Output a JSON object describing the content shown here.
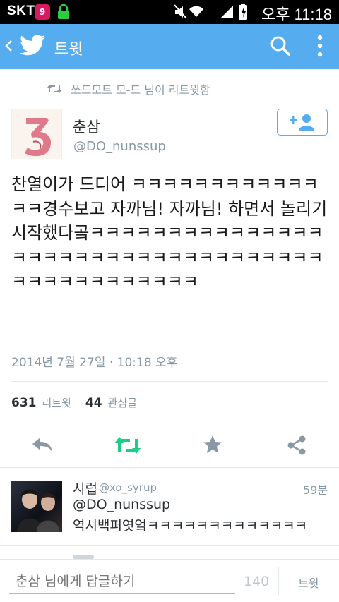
{
  "status_bar": {
    "carrier": "SKT",
    "notification_count": "9",
    "time": "오후 11:18"
  },
  "app_bar": {
    "title": "트윗"
  },
  "retweet_header": {
    "text": "쏘드모트 모-드 님이 리트윗함"
  },
  "tweet": {
    "author_name": "춘삼",
    "author_handle": "@DO_nunssup",
    "text": "찬열이가 드디어 ㅋㅋㅋㅋㅋㅋㅋㅋㅋㅋㅋㅋㅋㅋ경수보고 자까님! 자까님! 하면서 놀리기 시작했다곸ㅋㅋㅋㅋㅋㅋㅋㅋㅋㅋㅋㅋㅋㅋㅋㅋㅋㅋㅋㅋㅋㅋㅋㅋㅋㅋㅋㅋㅋㅋㅋㅋㅋㅋㅋㅋㅋㅋㅋㅋㅋㅋㅋㅋㅋㅋㅋ",
    "timestamp": "2014년 7월 27일 · 10:18 오후",
    "retweet_count": "631",
    "retweet_label": "리트윗",
    "favorite_count": "44",
    "favorite_label": "관심글"
  },
  "actions": {
    "reply_icon": "reply-icon",
    "retweet_icon": "retweet-icon",
    "favorite_icon": "star-icon",
    "share_icon": "share-icon",
    "retweet_color": "#19cf86"
  },
  "reply": {
    "name": "시럽",
    "handle": "@xo_syrup",
    "time": "59분",
    "line1": "@DO_nunssup",
    "line2": "역시백퍼엿엌ㅋㅋㅋㅋㅋㅋㅋㅋㅋㅋㅋㅋㅋ"
  },
  "compose": {
    "placeholder": "춘삼 님에게 답글하기",
    "counter": "140",
    "send_label": "트윗"
  },
  "colors": {
    "brand": "#55acee",
    "muted": "#8899a6"
  }
}
